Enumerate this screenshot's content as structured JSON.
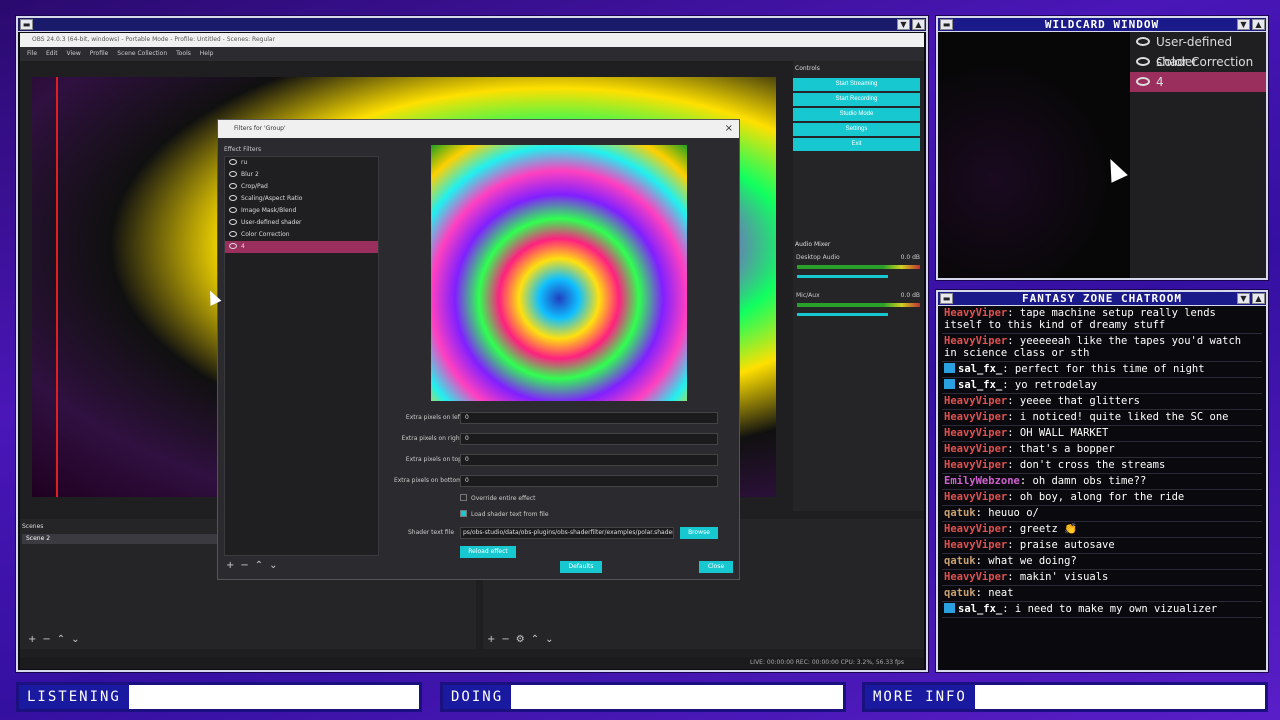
{
  "obs": {
    "title": "OBS 24.0.3 (64-bit, windows) - Portable Mode - Profile: Untitled - Scenes: Regular",
    "menu": [
      "File",
      "Edit",
      "View",
      "Profile",
      "Scene Collection",
      "Tools",
      "Help"
    ],
    "controls_label": "Controls",
    "controls": [
      "Start Streaming",
      "Start Recording",
      "Studio Mode",
      "Settings",
      "Exit"
    ],
    "audio_mixer_label": "Audio Mixer",
    "desktop_audio": "Desktop Audio",
    "desktop_db": "0.0 dB",
    "mic_aux": "Mic/Aux",
    "mic_db": "0.0 dB",
    "scenes_label": "Scenes",
    "scene_item": "Scene 2",
    "status": "LIVE: 00:00:00    REC: 00:00:00    CPU: 3.2%, 56.33 fps"
  },
  "dialog": {
    "title": "Filters for 'Group'",
    "effect_filters_label": "Effect Filters",
    "filters": [
      "ru",
      "Blur 2",
      "Crop/Pad",
      "Scaling/Aspect Ratio",
      "Image Mask/Blend",
      "User-defined shader",
      "Color Correction",
      "4"
    ],
    "props": [
      {
        "label": "Extra pixels on left",
        "value": "0"
      },
      {
        "label": "Extra pixels on right",
        "value": "0"
      },
      {
        "label": "Extra pixels on top",
        "value": "0"
      },
      {
        "label": "Extra pixels on bottom",
        "value": "0"
      }
    ],
    "override_label": "Override entire effect",
    "load_shader_label": "Load shader text from file",
    "shader_file_label": "Shader text file",
    "shader_file_value": "ps/obs-studio/data/obs-plugins/obs-shaderfilter/examples/polar.shader",
    "browse": "Browse",
    "reload": "Reload effect",
    "defaults": "Defaults",
    "close": "Close"
  },
  "wildcard": {
    "title": "WILDCARD WINDOW",
    "sources": [
      "User-defined shader",
      "Color Correction",
      "4"
    ]
  },
  "chat": {
    "title": "FANTASY ZONE CHATROOM",
    "messages": [
      {
        "user": "HeavyViper",
        "color": "#e05050",
        "text": "tape machine setup really lends itself to this kind of dreamy stuff"
      },
      {
        "user": "HeavyViper",
        "color": "#e05050",
        "text": "yeeeeeah like the tapes you'd watch in science class or sth"
      },
      {
        "user": "sal_fx_",
        "color": "#ffffff",
        "text": "perfect for this time of night",
        "badge": true
      },
      {
        "user": "sal_fx_",
        "color": "#ffffff",
        "text": "yo retrodelay",
        "badge": true
      },
      {
        "user": "HeavyViper",
        "color": "#e05050",
        "text": "yeeee that glitters"
      },
      {
        "user": "HeavyViper",
        "color": "#e05050",
        "text": "i noticed! quite liked the SC one"
      },
      {
        "user": "HeavyViper",
        "color": "#e05050",
        "text": "OH WALL MARKET"
      },
      {
        "user": "HeavyViper",
        "color": "#e05050",
        "text": "that's a bopper"
      },
      {
        "user": "HeavyViper",
        "color": "#e05050",
        "text": "don't cross the streams"
      },
      {
        "user": "EmilyWebzone",
        "color": "#d060d0",
        "text": "oh damn obs time??"
      },
      {
        "user": "HeavyViper",
        "color": "#e05050",
        "text": "oh boy, along for the ride"
      },
      {
        "user": "qatuk",
        "color": "#c8a070",
        "text": "heuuo o/"
      },
      {
        "user": "HeavyViper",
        "color": "#e05050",
        "text": "greetz 👏"
      },
      {
        "user": "HeavyViper",
        "color": "#e05050",
        "text": "praise autosave"
      },
      {
        "user": "qatuk",
        "color": "#c8a070",
        "text": "what we doing?"
      },
      {
        "user": "HeavyViper",
        "color": "#e05050",
        "text": "makin' visuals"
      },
      {
        "user": "qatuk",
        "color": "#c8a070",
        "text": "neat"
      },
      {
        "user": "sal_fx_",
        "color": "#ffffff",
        "text": "i need to make my own vizualizer",
        "badge": true
      }
    ]
  },
  "bars": {
    "listening": "LISTENING",
    "doing": "DOING",
    "more_info": "MORE INFO"
  }
}
